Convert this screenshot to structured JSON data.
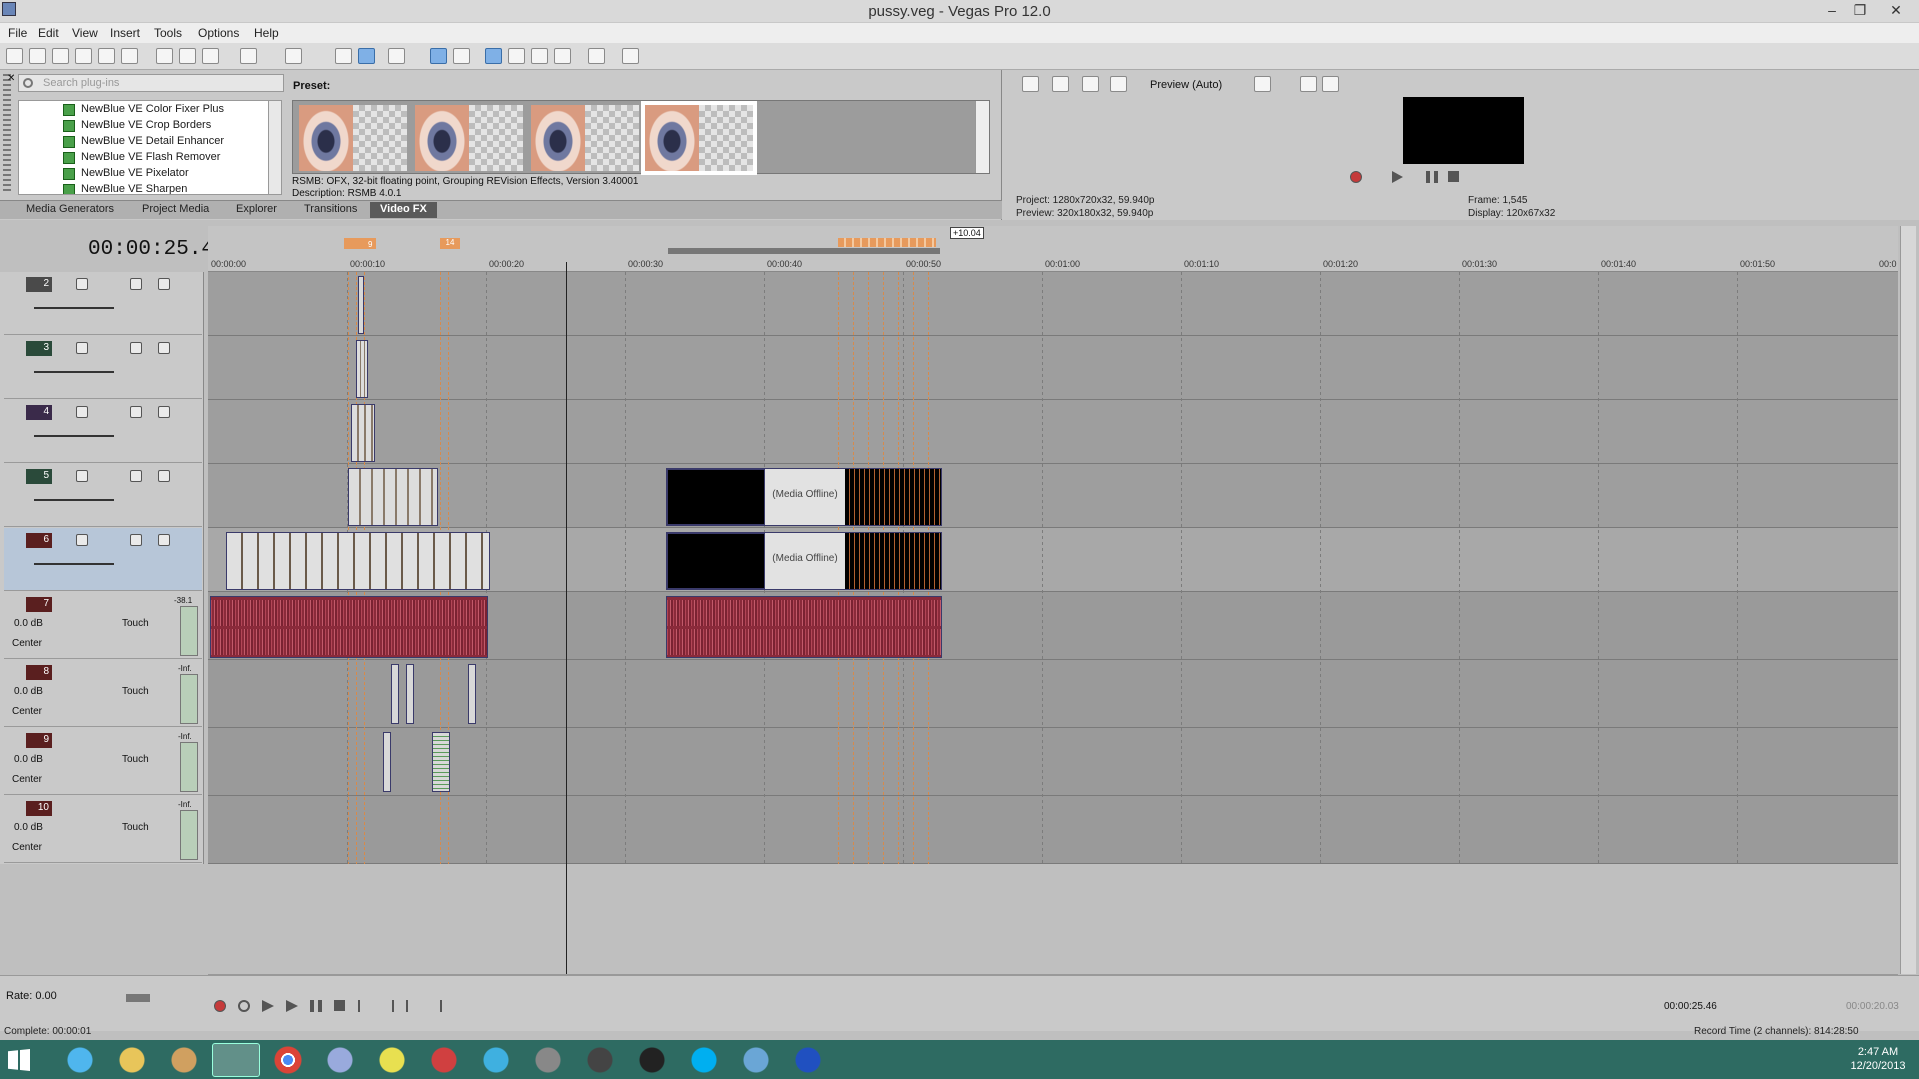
{
  "window": {
    "title": "pussy.veg - Vegas Pro 12.0"
  },
  "menu": [
    "File",
    "Edit",
    "View",
    "Insert",
    "Tools",
    "Options",
    "Help"
  ],
  "plugins": {
    "search_placeholder": "Search plug-ins",
    "items": [
      "NewBlue VE Color Fixer Plus",
      "NewBlue VE Crop Borders",
      "NewBlue VE Detail Enhancer",
      "NewBlue VE Flash Remover",
      "NewBlue VE Pixelator",
      "NewBlue VE Sharpen"
    ],
    "preset_label": "Preset:",
    "description_line1": "RSMB: OFX, 32-bit floating point, Grouping REVision Effects, Version 3.40001",
    "description_line2": "Description: RSMB 4.0.1",
    "tabs": [
      "Media Generators",
      "Project Media",
      "Explorer",
      "Transitions",
      "Video FX"
    ],
    "active_tab": "Video FX"
  },
  "preview": {
    "mode": "Preview (Auto)",
    "project": "Project:   1280x720x32, 59.940p",
    "preview": "Preview:  320x180x32, 59.940p",
    "frame": "Frame:     1,545",
    "display": "Display:   120x67x32"
  },
  "timeline": {
    "timecode": "00:00:25.46",
    "ruler_ticks": [
      "00:00:00",
      "00:00:10",
      "00:00:20",
      "00:00:30",
      "00:00:40",
      "00:00:50",
      "00:01:00",
      "00:01:10",
      "00:01:20",
      "00:01:30",
      "00:01:40",
      "00:01:50",
      "00:0"
    ],
    "marker_14": "14",
    "marker_9": "9",
    "region_label": "+10.04",
    "media_offline": "(Media Offline)"
  },
  "video_tracks": [
    {
      "num": "2"
    },
    {
      "num": "3"
    },
    {
      "num": "4"
    },
    {
      "num": "5"
    },
    {
      "num": "6"
    }
  ],
  "audio_tracks": [
    {
      "num": "7",
      "vol": "0.0 dB",
      "pan": "Center",
      "mode": "Touch",
      "meter": "-38.1"
    },
    {
      "num": "8",
      "vol": "0.0 dB",
      "pan": "Center",
      "mode": "Touch",
      "meter": "-Inf."
    },
    {
      "num": "9",
      "vol": "0.0 dB",
      "pan": "Center",
      "mode": "Touch",
      "meter": "-Inf."
    },
    {
      "num": "10",
      "vol": "0.0 dB",
      "pan": "Center",
      "mode": "Touch",
      "meter": "-Inf."
    }
  ],
  "transport": {
    "rate": "Rate: 0.00",
    "complete": "Complete: 00:00:01",
    "cursor_time": "00:00:25.46",
    "selection_time": "00:00:20.03",
    "record_time": "Record Time (2 channels): 814:28:50"
  },
  "clock": {
    "time": "2:47 AM",
    "date": "12/20/2013"
  }
}
